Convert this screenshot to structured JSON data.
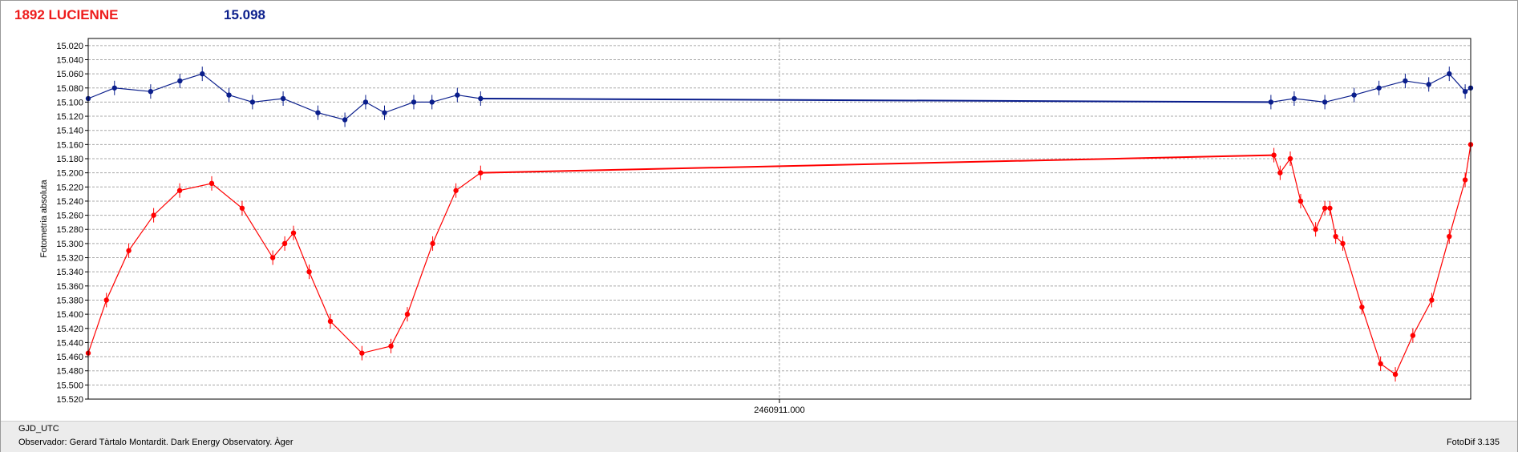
{
  "header": {
    "object_name": "1892 LUCIENNE",
    "comparison_mag": "15.098"
  },
  "footer": {
    "x_axis_label": "GJD_UTC",
    "observer": "Observador: Gerard Tàrtalo Montardit.  Dark Energy Observatory.  Àger",
    "software": "FotoDif 3.135"
  },
  "chart_data": {
    "type": "scatter",
    "title": "",
    "xlabel": "",
    "ylabel": "Fotometria absoluta",
    "y_inverted": true,
    "ylim": [
      15.52,
      15.01
    ],
    "yticks": [
      "15.020",
      "15.040",
      "15.060",
      "15.080",
      "15.100",
      "15.120",
      "15.140",
      "15.160",
      "15.180",
      "15.200",
      "15.220",
      "15.240",
      "15.260",
      "15.280",
      "15.300",
      "15.320",
      "15.340",
      "15.360",
      "15.380",
      "15.400",
      "15.420",
      "15.440",
      "15.460",
      "15.480",
      "15.500",
      "15.520"
    ],
    "xlim": [
      2460910.7,
      2460911.3
    ],
    "xticks": [
      {
        "value": 2460911.0,
        "label": "2460911.000"
      }
    ],
    "grid": true,
    "colors": {
      "target": "#ff0000",
      "comparison": "#0a1e8c"
    },
    "series": [
      {
        "id": "target",
        "segments": [
          {
            "x": [
              2460910.7,
              2460910.7079,
              2460910.7176,
              2460910.7284,
              2460910.7397,
              2460910.7536,
              2460910.7668,
              2460910.7801,
              2460910.7853,
              2460910.7891,
              2460910.7959,
              2460910.8051,
              2460910.8188,
              2460910.8314,
              2460910.8385,
              2460910.8495,
              2460910.8596,
              2460910.8703
            ],
            "y": [
              15.455,
              15.38,
              15.31,
              15.26,
              15.225,
              15.215,
              15.25,
              15.32,
              15.3,
              15.285,
              15.34,
              15.41,
              15.455,
              15.445,
              15.4,
              15.3,
              15.225,
              15.2
            ]
          },
          {
            "x": [
              2460911.2146,
              2460911.2173,
              2460911.2217,
              2460911.2262,
              2460911.2327,
              2460911.2367,
              2460911.2389,
              2460911.2414,
              2460911.2445,
              2460911.2528,
              2460911.2609,
              2460911.2673,
              2460911.2749,
              2460911.2831,
              2460911.2907,
              2460911.2976,
              2460911.3
            ],
            "y": [
              15.175,
              15.2,
              15.18,
              15.24,
              15.28,
              15.25,
              15.25,
              15.29,
              15.3,
              15.39,
              15.47,
              15.485,
              15.43,
              15.38,
              15.29,
              15.21,
              15.16
            ]
          }
        ]
      },
      {
        "id": "comparison",
        "segments": [
          {
            "x": [
              2460910.7,
              2460910.7114,
              2460910.7271,
              2460910.7398,
              2460910.7495,
              2460910.7611,
              2460910.7713,
              2460910.7846,
              2460910.7997,
              2460910.8114,
              2460910.8204,
              2460910.8286,
              2460910.8413,
              2460910.8492,
              2460910.8602,
              2460910.8703
            ],
            "y": [
              15.095,
              15.08,
              15.085,
              15.07,
              15.06,
              15.09,
              15.1,
              15.095,
              15.115,
              15.125,
              15.1,
              15.115,
              15.1,
              15.1,
              15.09,
              15.095
            ]
          },
          {
            "x": [
              2460911.2133,
              2460911.2234,
              2460911.2367,
              2460911.2494,
              2460911.2602,
              2460911.2716,
              2460911.2818,
              2460911.2907,
              2460911.2976,
              2460911.3
            ],
            "y": [
              15.1,
              15.095,
              15.1,
              15.09,
              15.08,
              15.07,
              15.075,
              15.06,
              15.085,
              15.08
            ]
          }
        ]
      }
    ]
  }
}
